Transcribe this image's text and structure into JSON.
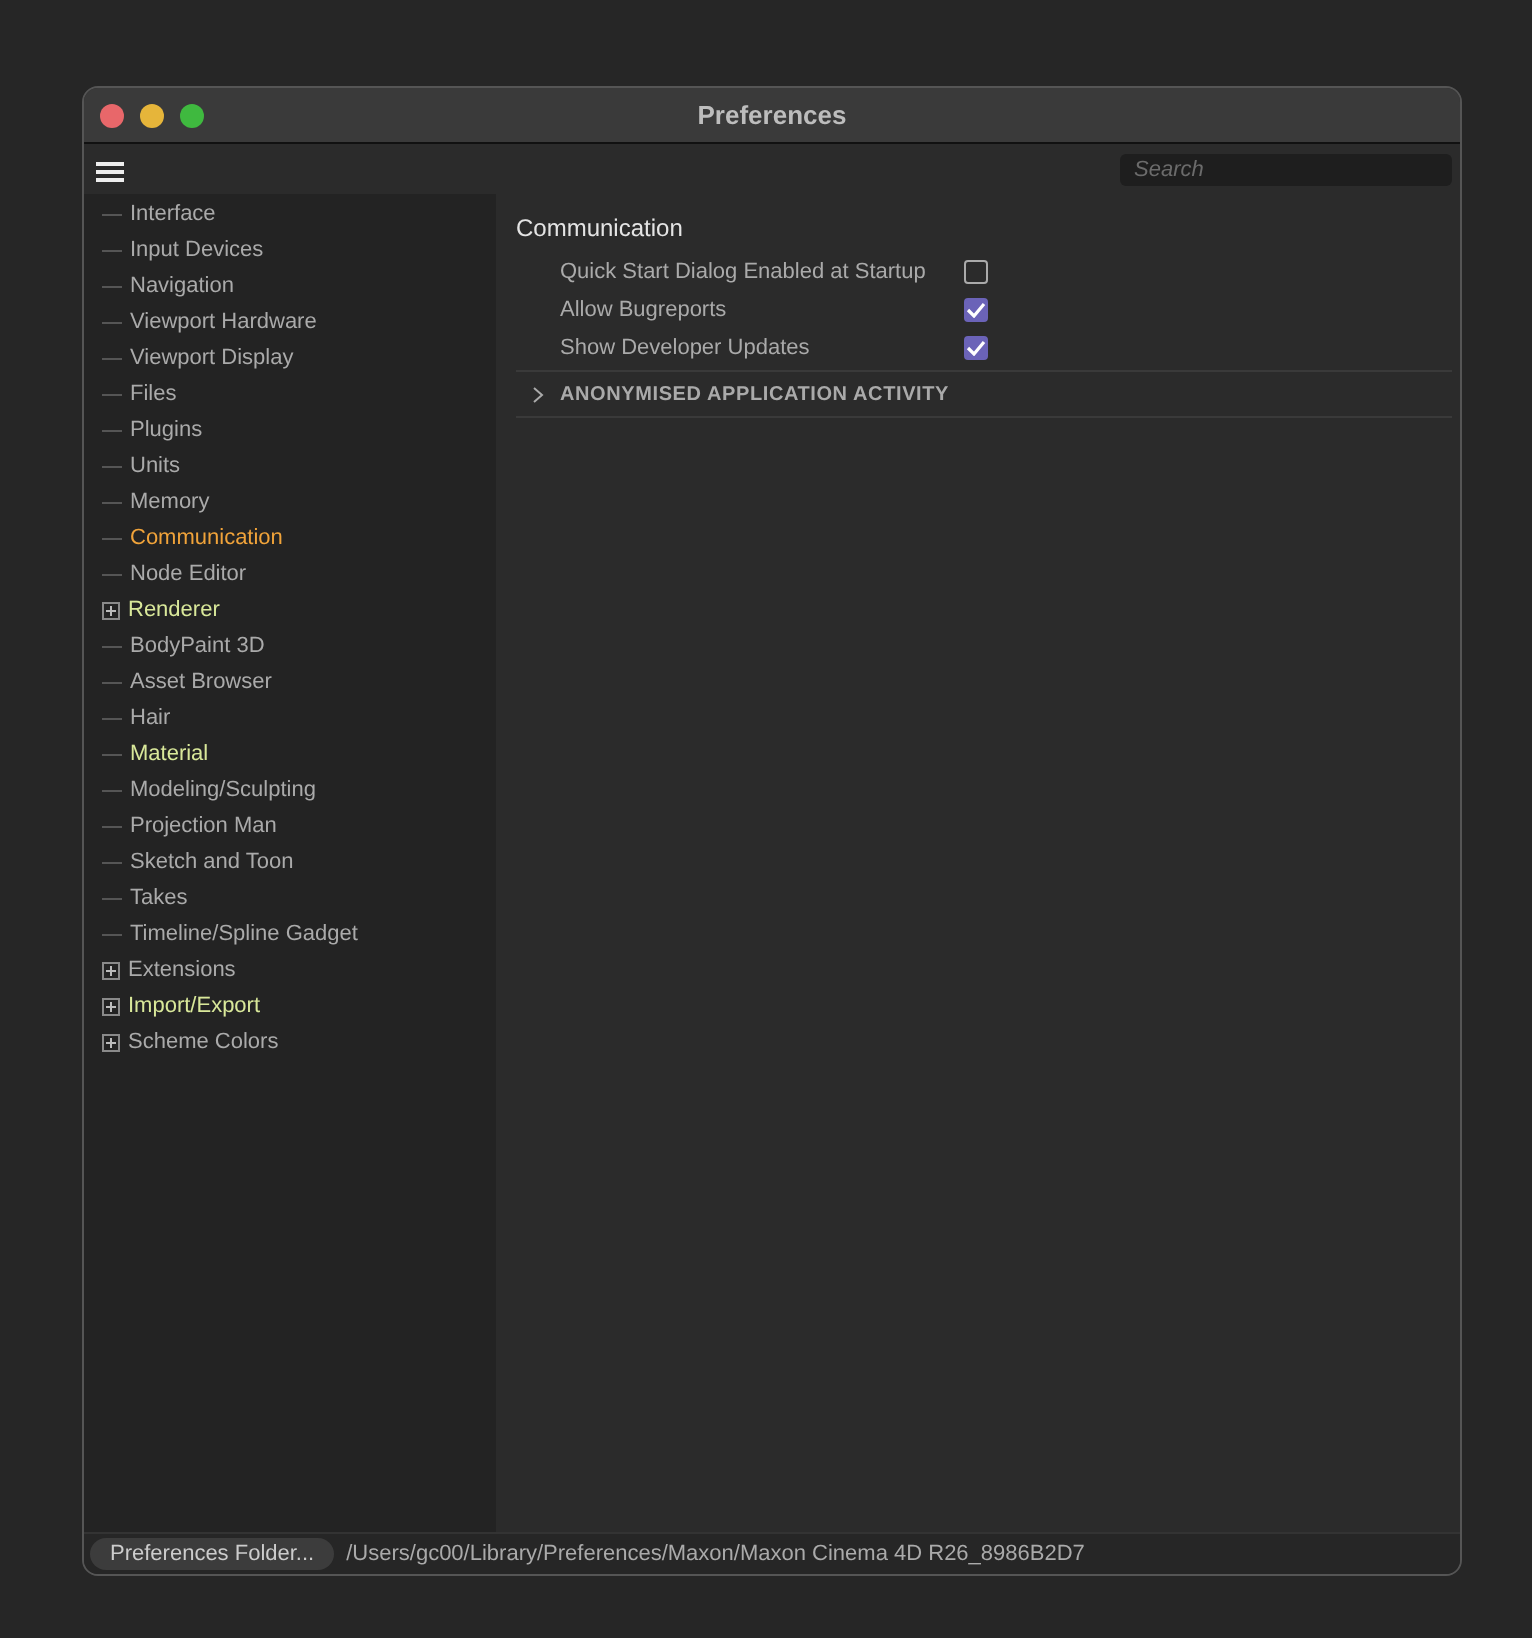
{
  "window": {
    "title": "Preferences"
  },
  "search": {
    "placeholder": "Search"
  },
  "sidebar": {
    "items": [
      {
        "label": "Interface",
        "kind": "page",
        "selected": false,
        "modified": false
      },
      {
        "label": "Input Devices",
        "kind": "page",
        "selected": false,
        "modified": false
      },
      {
        "label": "Navigation",
        "kind": "page",
        "selected": false,
        "modified": false
      },
      {
        "label": "Viewport Hardware",
        "kind": "page",
        "selected": false,
        "modified": false
      },
      {
        "label": "Viewport Display",
        "kind": "page",
        "selected": false,
        "modified": false
      },
      {
        "label": "Files",
        "kind": "page",
        "selected": false,
        "modified": false
      },
      {
        "label": "Plugins",
        "kind": "page",
        "selected": false,
        "modified": false
      },
      {
        "label": "Units",
        "kind": "page",
        "selected": false,
        "modified": false
      },
      {
        "label": "Memory",
        "kind": "page",
        "selected": false,
        "modified": false
      },
      {
        "label": "Communication",
        "kind": "page",
        "selected": true,
        "modified": false
      },
      {
        "label": "Node Editor",
        "kind": "page",
        "selected": false,
        "modified": false
      },
      {
        "label": "Renderer",
        "kind": "group",
        "selected": false,
        "modified": true
      },
      {
        "label": "BodyPaint 3D",
        "kind": "page",
        "selected": false,
        "modified": false
      },
      {
        "label": "Asset Browser",
        "kind": "page",
        "selected": false,
        "modified": false
      },
      {
        "label": "Hair",
        "kind": "page",
        "selected": false,
        "modified": false
      },
      {
        "label": "Material",
        "kind": "page",
        "selected": false,
        "modified": true
      },
      {
        "label": "Modeling/Sculpting",
        "kind": "page",
        "selected": false,
        "modified": false
      },
      {
        "label": "Projection Man",
        "kind": "page",
        "selected": false,
        "modified": false
      },
      {
        "label": "Sketch and Toon",
        "kind": "page",
        "selected": false,
        "modified": false
      },
      {
        "label": "Takes",
        "kind": "page",
        "selected": false,
        "modified": false
      },
      {
        "label": "Timeline/Spline Gadget",
        "kind": "page",
        "selected": false,
        "modified": false
      },
      {
        "label": "Extensions",
        "kind": "group",
        "selected": false,
        "modified": false
      },
      {
        "label": "Import/Export",
        "kind": "group",
        "selected": false,
        "modified": true
      },
      {
        "label": "Scheme Colors",
        "kind": "group",
        "selected": false,
        "modified": false
      }
    ]
  },
  "content": {
    "heading": "Communication",
    "options": [
      {
        "label": "Quick Start Dialog Enabled at Startup",
        "checked": false
      },
      {
        "label": "Allow Bugreports",
        "checked": true
      },
      {
        "label": "Show Developer Updates",
        "checked": true
      }
    ],
    "section": {
      "label": "ANONYMISED APPLICATION ACTIVITY",
      "expanded": false
    }
  },
  "footer": {
    "button": "Preferences Folder...",
    "path": "/Users/gc00/Library/Preferences/Maxon/Maxon Cinema 4D R26_8986B2D7"
  }
}
